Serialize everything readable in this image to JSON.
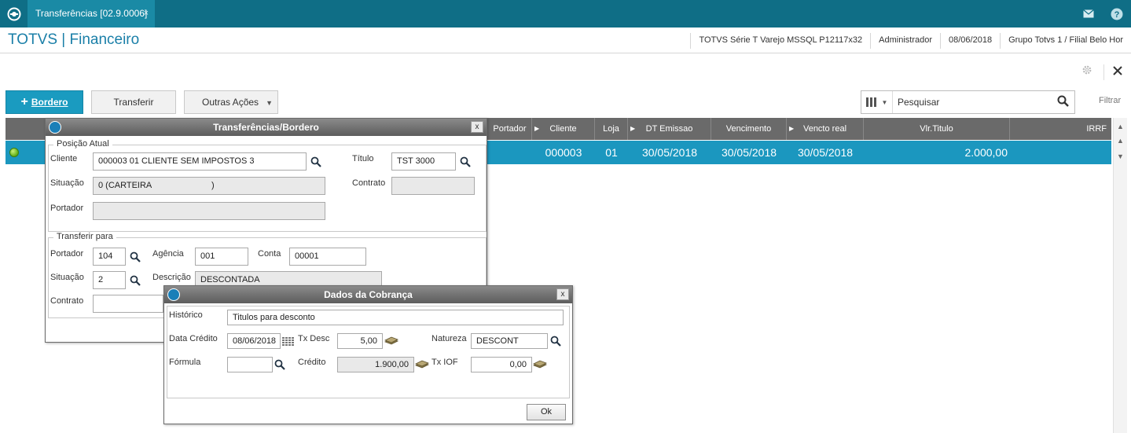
{
  "tab": {
    "title": "Transferências [02.9.0006]",
    "close": "×"
  },
  "app": {
    "title": "TOTVS | Financeiro"
  },
  "header_info": {
    "system": "TOTVS Série T Varejo MSSQL P12117x32",
    "user": "Administrador",
    "date": "08/06/2018",
    "company": "Grupo Totvs 1 / Filial Belo Hor"
  },
  "actions": {
    "bordero": "Bordero",
    "bordero_plus": "+",
    "transferir": "Transferir",
    "outras": "Outras Ações"
  },
  "search": {
    "placeholder": "Pesquisar",
    "filtrar": "Filtrar"
  },
  "grid": {
    "columns": [
      "Portador",
      "Cliente",
      "Loja",
      "DT Emissao",
      "Vencimento",
      "Vencto real",
      "Vlr.Titulo",
      "IRRF"
    ],
    "row": {
      "cliente": "000003",
      "loja": "01",
      "dt_emissao": "30/05/2018",
      "vencimento": "30/05/2018",
      "vencto_real": "30/05/2018",
      "vlr_titulo": "2.000,00"
    }
  },
  "dialog_transfer": {
    "title": "Transferências/Bordero",
    "close": "x",
    "posicao_atual": {
      "legend": "Posição Atual",
      "cliente_label": "Cliente",
      "cliente_value": "000003 01 CLIENTE SEM IMPOSTOS 3",
      "titulo_label": "Título",
      "titulo_value": "TST 3000",
      "situacao_label": "Situação",
      "situacao_value": "0 (CARTEIRA                         )",
      "contrato_label": "Contrato",
      "contrato_value": "",
      "portador_label": "Portador",
      "portador_value": ""
    },
    "transferir_para": {
      "legend": "Transferir para",
      "portador_label": "Portador",
      "portador_value": "104",
      "agencia_label": "Agência",
      "agencia_value": "001",
      "conta_label": "Conta",
      "conta_value": "00001",
      "situacao_label": "Situação",
      "situacao_value": "2",
      "descricao_label": "Descrição",
      "descricao_value": "DESCONTADA",
      "contrato_label": "Contrato",
      "contrato_value": ""
    }
  },
  "dialog_cobranca": {
    "title": "Dados da Cobrança",
    "close": "x",
    "historico_label": "Histórico",
    "historico_value": "Titulos para desconto",
    "data_credito_label": "Data Crédito",
    "data_credito_value": "08/06/2018",
    "tx_desc_label": "Tx Desc",
    "tx_desc_value": "5,00",
    "natureza_label": "Natureza",
    "natureza_value": "DESCONT",
    "formula_label": "Fórmula",
    "formula_value": "",
    "credito_label": "Crédito",
    "credito_value": "1.900,00",
    "tx_iof_label": "Tx IOF",
    "tx_iof_value": "0,00",
    "ok": "Ok"
  }
}
